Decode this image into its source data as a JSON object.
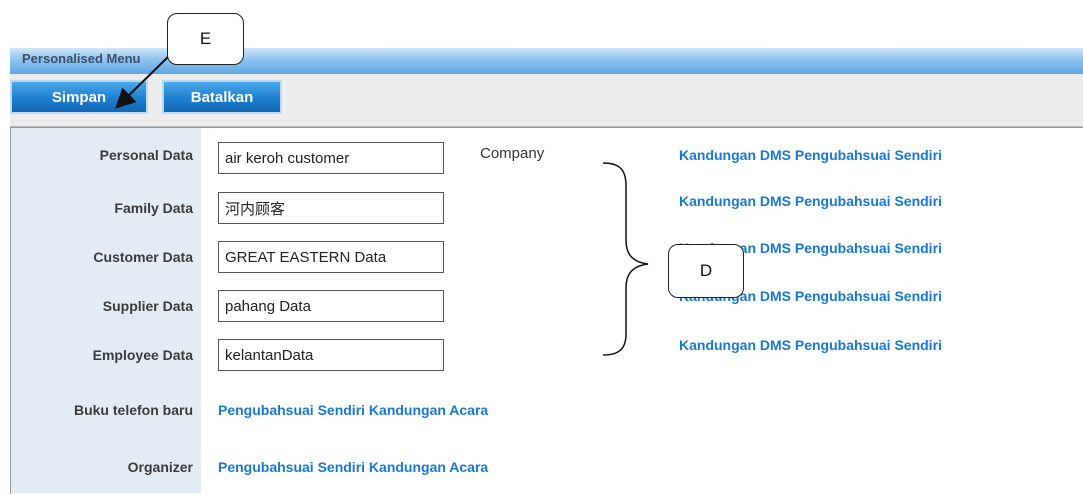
{
  "header": {
    "title": "Personalised Menu"
  },
  "toolbar": {
    "save_label": "Simpan",
    "cancel_label": "Batalkan"
  },
  "form": {
    "company_label": "Company",
    "rows": [
      {
        "label": "Personal Data",
        "value": "air keroh customer",
        "link": "Kandungan DMS Pengubahsuai Sendiri"
      },
      {
        "label": "Family Data",
        "value": "河内顾客",
        "link": "Kandungan DMS Pengubahsuai Sendiri"
      },
      {
        "label": "Customer Data",
        "value": "GREAT EASTERN Data",
        "link": "Kandungan DMS Pengubahsuai Sendiri"
      },
      {
        "label": "Supplier Data",
        "value": "pahang Data",
        "link": "Kandungan DMS Pengubahsuai Sendiri"
      },
      {
        "label": "Employee Data",
        "value": "kelantanData",
        "link": "Kandungan DMS Pengubahsuai Sendiri"
      }
    ],
    "extra_rows": [
      {
        "label": "Buku telefon baru",
        "link": "Pengubahsuai Sendiri Kandungan Acara"
      },
      {
        "label": "Organizer",
        "link": "Pengubahsuai Sendiri Kandungan Acara"
      }
    ]
  },
  "annotations": {
    "e_label": "E",
    "d_label": "D"
  },
  "colors": {
    "link": "#1777d4",
    "button": "#1f7fcf",
    "label_column": "#e3ebf5",
    "header": "#8fc3ef"
  }
}
